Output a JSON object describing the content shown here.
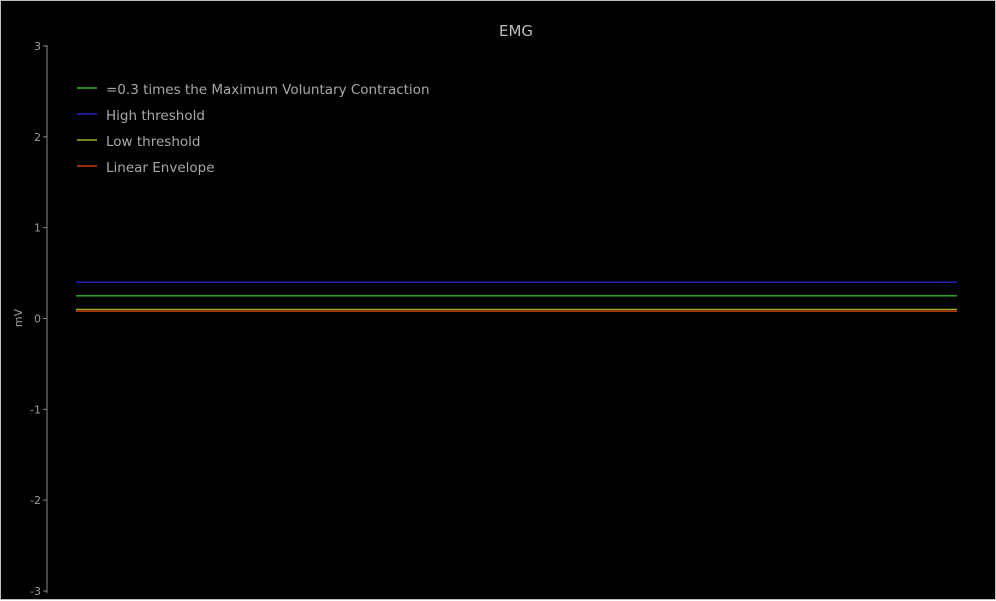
{
  "chart_data": {
    "type": "line",
    "title": "EMG",
    "xlabel": "",
    "ylabel": "mV",
    "ylim": [
      -3,
      3
    ],
    "y_ticks": [
      "3",
      "2",
      "1",
      "0",
      "-1",
      "-2",
      "-3"
    ],
    "y_tick_values": [
      3,
      2,
      1,
      0,
      -1,
      -2,
      -3
    ],
    "grid": false,
    "legend_position": "top-left",
    "series": [
      {
        "name": "=0.3 times the Maximum Voluntary Contraction",
        "color": "#2fb52f",
        "y": 0.25
      },
      {
        "name": "High threshold",
        "color": "#2222c8",
        "y": 0.4
      },
      {
        "name": "Low threshold",
        "color": "#a0b028",
        "y": 0.1
      },
      {
        "name": "Linear Envelope",
        "color": "#c83c14",
        "y": 0.08
      }
    ]
  },
  "colors": {
    "background": "#000000",
    "axis": "#8a8a8a",
    "text": "#a8a8a8"
  }
}
